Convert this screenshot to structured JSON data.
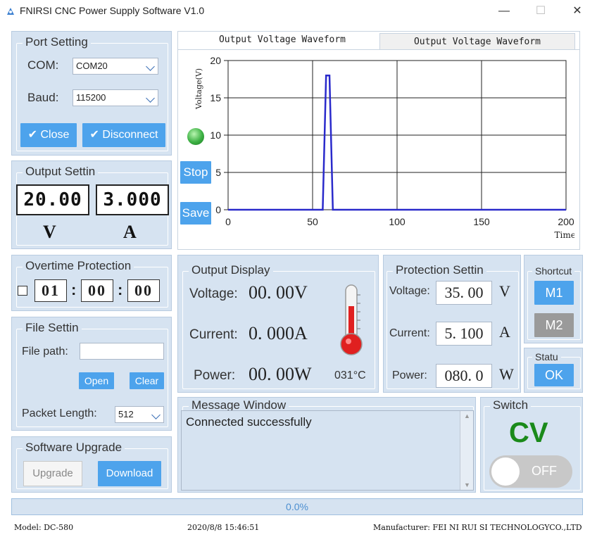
{
  "window": {
    "title": "FNIRSI CNC Power Supply Software V1.0",
    "minimize_glyph": "—",
    "maximize_glyph": "☐",
    "close_glyph": "✕"
  },
  "port_setting": {
    "legend": "Port Setting",
    "com_label": "COM:",
    "com_value": "COM20",
    "baud_label": "Baud:",
    "baud_value": "115200",
    "close_label": "Close",
    "disconnect_label": "Disconnect",
    "check_glyph": "✔"
  },
  "output_setting": {
    "legend": "Output Settin",
    "voltage": "20.00",
    "current": "3.000",
    "voltage_unit": "V",
    "current_unit": "A"
  },
  "chart_controls": {
    "stop_label": "Stop",
    "save_label": "Save",
    "indicator_color": "#3cb043"
  },
  "chart_tabs": [
    "Output Voltage Waveform",
    "Output Voltage Waveform"
  ],
  "chart_data": {
    "type": "line",
    "ylabel": "Voltage(V)",
    "xlabel": "Times",
    "xlim": [
      0,
      200
    ],
    "ylim": [
      0,
      20
    ],
    "x_ticks": [
      0,
      50,
      100,
      150,
      200
    ],
    "y_ticks": [
      0,
      5,
      10,
      15,
      20
    ],
    "grid": true,
    "series": [
      {
        "color": "#2a2acb",
        "x": [
          0,
          56,
          58,
          60,
          62,
          200
        ],
        "y": [
          0,
          0,
          18,
          18,
          0,
          0
        ]
      }
    ]
  },
  "overtime": {
    "legend": "Overtime Protection",
    "hours": "01",
    "minutes": "00",
    "seconds": "00",
    "separator": ":"
  },
  "file_setting": {
    "legend": "File Settin",
    "path_label": "File path:",
    "path_value": "",
    "open_label": "Open",
    "clear_label": "Clear",
    "packet_label": "Packet Length:",
    "packet_value": "512"
  },
  "software_upgrade": {
    "legend": "Software Upgrade",
    "upgrade_label": "Upgrade",
    "download_label": "Download"
  },
  "output_display": {
    "legend": "Output Display",
    "voltage_label": "Voltage:",
    "voltage_value": "00. 00V",
    "current_label": "Current:",
    "current_value": "0. 000A",
    "power_label": "Power:",
    "power_value": "00. 00W",
    "temperature": "031°C"
  },
  "protection": {
    "legend": "Protection Settin",
    "voltage_label": "Voltage:",
    "voltage_value": "35. 00",
    "voltage_unit": "V",
    "current_label": "Current:",
    "current_value": "5. 100",
    "current_unit": "A",
    "power_label": "Power:",
    "power_value": "080. 0",
    "power_unit": "W"
  },
  "shortcut": {
    "legend": "Shortcut",
    "m1_label": "M1",
    "m2_label": "M2"
  },
  "status_box": {
    "legend": "Statu",
    "ok_label": "OK"
  },
  "message_window": {
    "legend": "Message Window",
    "text": "Connected successfully"
  },
  "switch_box": {
    "legend": "Switch",
    "mode": "CV",
    "mode_color": "#1a8a1a",
    "toggle_label": "OFF"
  },
  "progress": {
    "text": "0.0%",
    "value": 0
  },
  "statusbar": {
    "model": "Model: DC-580",
    "datetime": "2020/8/8 15:46:51",
    "manufacturer": "Manufacturer: FEI NI RUI SI TECHNOLOGYCO.,LTD"
  }
}
